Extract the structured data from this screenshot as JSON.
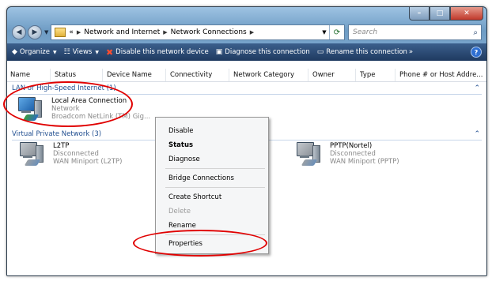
{
  "address": {
    "crumbs": [
      "«",
      "Network and Internet",
      "Network Connections"
    ],
    "search_placeholder": "Search"
  },
  "toolbar": {
    "organize": "Organize",
    "views": "Views",
    "disable": "Disable this network device",
    "diagnose": "Diagnose this connection",
    "rename": "Rename this connection",
    "more": "»"
  },
  "columns": [
    "Name",
    "Status",
    "Device Name",
    "Connectivity",
    "Network Category",
    "Owner",
    "Type",
    "Phone # or Host Addre..."
  ],
  "groups": {
    "lan": {
      "title": "LAN or High-Speed Internet (1)",
      "items": [
        {
          "name": "Local Area Connection",
          "status": "Network",
          "device": "Broadcom NetLink (TM) Gig..."
        }
      ]
    },
    "vpn": {
      "title": "Virtual Private Network (3)",
      "items": [
        {
          "name": "L2TP",
          "status": "Disconnected",
          "device": "WAN Miniport (L2TP)"
        },
        {
          "name": "PPTP(Nortel)",
          "status": "Disconnected",
          "device": "WAN Miniport (PPTP)"
        }
      ]
    }
  },
  "context_menu": {
    "disable": "Disable",
    "status": "Status",
    "diagnose": "Diagnose",
    "bridge": "Bridge Connections",
    "shortcut": "Create Shortcut",
    "delete": "Delete",
    "rename": "Rename",
    "properties": "Properties"
  },
  "annotation_color": "#e00000"
}
